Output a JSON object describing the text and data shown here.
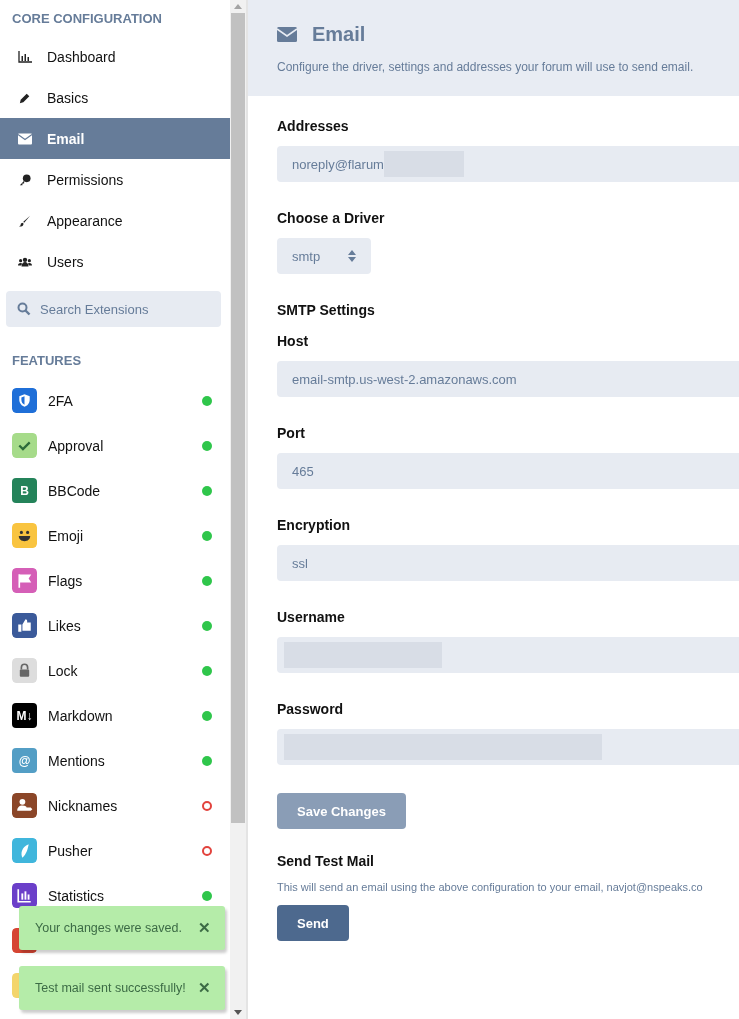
{
  "sidebar": {
    "core_heading": "CORE CONFIGURATION",
    "core_items": [
      {
        "label": "Dashboard",
        "kind": "chart",
        "selected": false
      },
      {
        "label": "Basics",
        "kind": "pencil",
        "selected": false
      },
      {
        "label": "Email",
        "kind": "envelope",
        "selected": true
      },
      {
        "label": "Permissions",
        "kind": "key",
        "selected": false
      },
      {
        "label": "Appearance",
        "kind": "brush",
        "selected": false
      },
      {
        "label": "Users",
        "kind": "users",
        "selected": false
      }
    ],
    "search": {
      "placeholder": "Search Extensions"
    },
    "features_heading": "FEATURES",
    "features": [
      {
        "label": "2FA",
        "kind": "shield",
        "color": "#1f6fd8",
        "enabled": true
      },
      {
        "label": "Approval",
        "kind": "check",
        "color": "#a6db8a",
        "enabled": true
      },
      {
        "label": "BBCode",
        "kind": "text",
        "icon_text": "B",
        "color": "#24835a",
        "enabled": true
      },
      {
        "label": "Emoji",
        "kind": "smiley",
        "color": "#f9c440",
        "enabled": true
      },
      {
        "label": "Flags",
        "kind": "flag",
        "color": "#d55fb7",
        "enabled": true
      },
      {
        "label": "Likes",
        "kind": "thumb",
        "color": "#3b5a9a",
        "enabled": true
      },
      {
        "label": "Lock",
        "kind": "lock",
        "color": "#dddddd",
        "enabled": true
      },
      {
        "label": "Markdown",
        "kind": "text",
        "icon_text": "M↓",
        "color": "#000000",
        "enabled": true
      },
      {
        "label": "Mentions",
        "kind": "text",
        "icon_text": "@",
        "color": "#539ec5",
        "enabled": true
      },
      {
        "label": "Nicknames",
        "kind": "person",
        "color": "#8b4628",
        "enabled": false
      },
      {
        "label": "Pusher",
        "kind": "feather",
        "color": "#40b6dc",
        "enabled": false
      },
      {
        "label": "Statistics",
        "kind": "chart",
        "color": "#6b3fc9",
        "enabled": true
      },
      {
        "kind": "blank",
        "color": "#d64533"
      },
      {
        "kind": "blank",
        "color": "#f3d56c"
      }
    ]
  },
  "page": {
    "title": "Email",
    "description": "Configure the driver, settings and addresses your forum will use to send email.",
    "addresses": {
      "label": "Addresses",
      "value": "noreply@flarum",
      "redacted": true
    },
    "driver": {
      "label": "Choose a Driver",
      "value": "smtp"
    },
    "smtp_heading": "SMTP Settings",
    "fields": [
      {
        "label": "Host",
        "value": "email-smtp.us-west-2.amazonaws.com",
        "redacted": false
      },
      {
        "label": "Port",
        "value": "465",
        "redacted": false
      },
      {
        "label": "Encryption",
        "value": "ssl",
        "redacted": false
      },
      {
        "label": "Username",
        "redacted": true
      },
      {
        "label": "Password",
        "redacted": true
      }
    ],
    "save_button": {
      "label": "Save Changes",
      "disabled": true
    },
    "test_heading": "Send Test Mail",
    "test_description": "This will send an email using the above configuration to your email, navjot@nspeaks.co",
    "send_button": "Send"
  },
  "toasts": [
    {
      "message": "Your changes were saved.",
      "close": "✕"
    },
    {
      "message": "Test mail sent successfully!",
      "close": "✕"
    }
  ]
}
